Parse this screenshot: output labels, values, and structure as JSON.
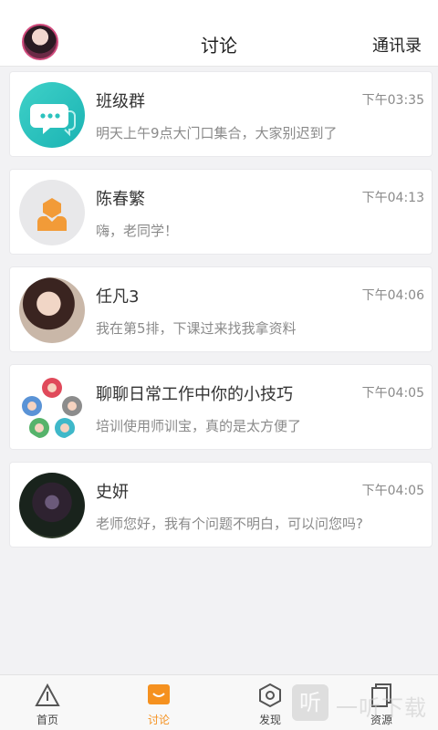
{
  "header": {
    "title": "讨论",
    "contacts_label": "通讯录"
  },
  "chats": [
    {
      "name": "班级群",
      "time": "下午03:35",
      "message": "明天上午9点大门口集合，大家别迟到了",
      "avatar": "group-chat-icon"
    },
    {
      "name": "陈春繁",
      "time": "下午04:13",
      "message": "嗨，老同学！",
      "avatar": "default-user-icon"
    },
    {
      "name": "任凡3",
      "time": "下午04:06",
      "message": "我在第5排，下课过来找我拿资料",
      "avatar": "user-photo"
    },
    {
      "name": "聊聊日常工作中你的小技巧",
      "time": "下午04:05",
      "message": "培训使用师训宝，真的是太方便了",
      "avatar": "multi-user-avatar"
    },
    {
      "name": "史妍",
      "time": "下午04:05",
      "message": "老师您好，我有个问题不明白，可以问您吗?",
      "avatar": "user-photo"
    }
  ],
  "tabs": [
    {
      "label": "首页",
      "icon": "triangle-home-icon"
    },
    {
      "label": "讨论",
      "icon": "chat-bubble-icon",
      "active": true
    },
    {
      "label": "发现",
      "icon": "hexagon-discover-icon"
    },
    {
      "label": "资源",
      "icon": "documents-icon"
    }
  ],
  "watermark": {
    "glyph": "听",
    "text": "一听下载"
  },
  "colors": {
    "accent": "#f5911f",
    "group_avatar": "#2cc3be",
    "default_avatar": "#f29b38"
  }
}
